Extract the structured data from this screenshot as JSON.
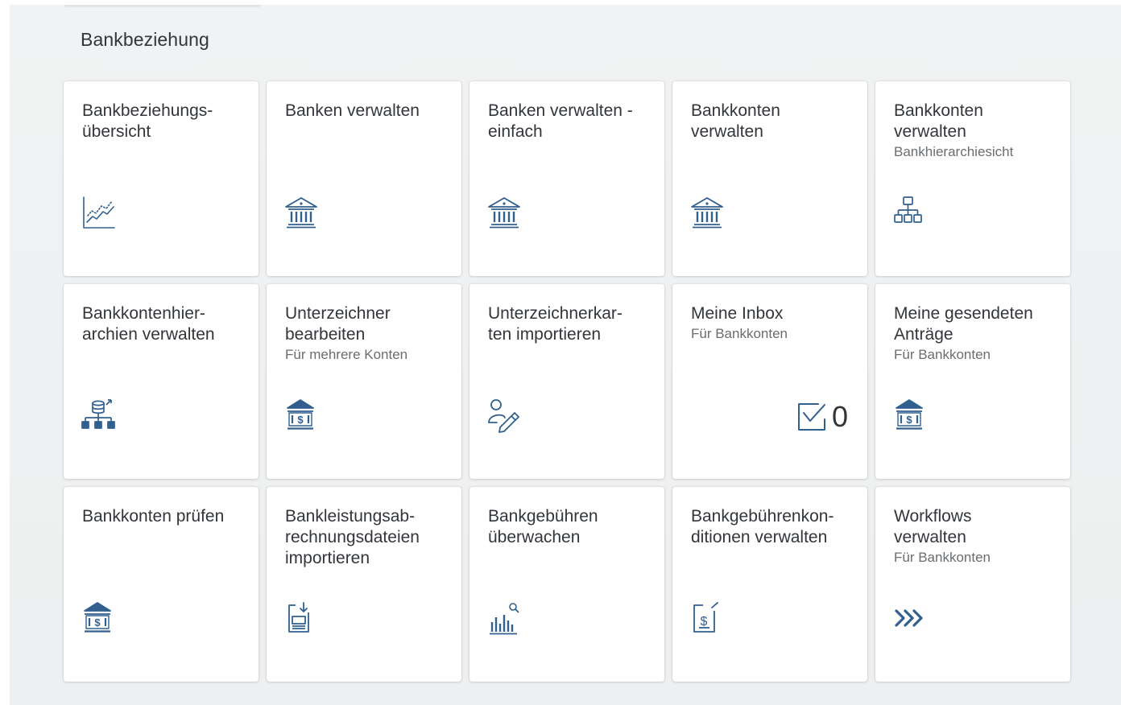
{
  "group": {
    "title": "Bankbeziehung"
  },
  "tiles": [
    {
      "title": "Bankbeziehungs-\nübersicht",
      "subtitle": "",
      "icon": "line-chart-icon"
    },
    {
      "title": "Banken verwalten",
      "subtitle": "",
      "icon": "bank-icon"
    },
    {
      "title": "Banken verwalten -\neinfach",
      "subtitle": "",
      "icon": "bank-icon"
    },
    {
      "title": "Bankkonten\nverwalten",
      "subtitle": "",
      "icon": "bank-icon"
    },
    {
      "title": "Bankkonten\nverwalten",
      "subtitle": "Bankhierarchiesicht",
      "icon": "hierarchy-icon"
    },
    {
      "title": "Bankkontenhier-\narchien verwalten",
      "subtitle": "",
      "icon": "database-hierarchy-icon"
    },
    {
      "title": "Unterzeichner\nbearbeiten",
      "subtitle": "Für mehrere Konten",
      "icon": "bank-account-icon"
    },
    {
      "title": "Unterzeichnerkar-\nten importieren",
      "subtitle": "",
      "icon": "signature-icon"
    },
    {
      "title": "Meine Inbox",
      "subtitle": "Für Bankkonten",
      "icon": "inbox-checkbox-icon",
      "count": "0"
    },
    {
      "title": "Meine gesendeten\nAnträge",
      "subtitle": "Für Bankkonten",
      "icon": "bank-account-icon"
    },
    {
      "title": "Bankkonten prüfen",
      "subtitle": "",
      "icon": "bank-account-icon"
    },
    {
      "title": "Bankleistungsab-\nrechnungsdateien\nimportieren",
      "subtitle": "",
      "icon": "import-document-icon"
    },
    {
      "title": "Bankgebühren\nüberwachen",
      "subtitle": "",
      "icon": "bar-chart-search-icon"
    },
    {
      "title": "Bankgebührenkon-\nditionen verwalten",
      "subtitle": "",
      "icon": "fee-document-icon"
    },
    {
      "title": "Workflows\nverwalten",
      "subtitle": "Für Bankkonten",
      "icon": "workflow-chevrons-icon"
    }
  ],
  "colors": {
    "icon": "#31608f",
    "title": "#32363a",
    "subtitle": "#6a6d70",
    "background": "#f0f1f2",
    "tile": "#ffffff"
  }
}
